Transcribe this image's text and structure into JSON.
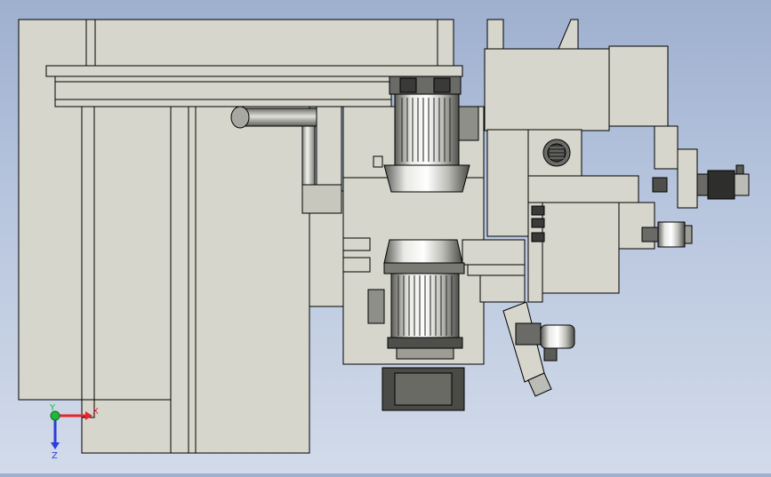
{
  "app": {
    "title": "",
    "view": "Front"
  },
  "triad": {
    "x_label": "X",
    "y_label": "Y",
    "z_label": "Z",
    "x_color": "#e8242c",
    "y_color": "#1fb83a",
    "z_color": "#2a3fd8"
  },
  "model": {
    "face_color": "#d7d6cc",
    "edge_color": "#000000",
    "components": [
      "machine-column",
      "top-motor",
      "bottom-motor",
      "accumulator-tank",
      "spindle-head",
      "servo-motor",
      "gear-motor"
    ]
  }
}
